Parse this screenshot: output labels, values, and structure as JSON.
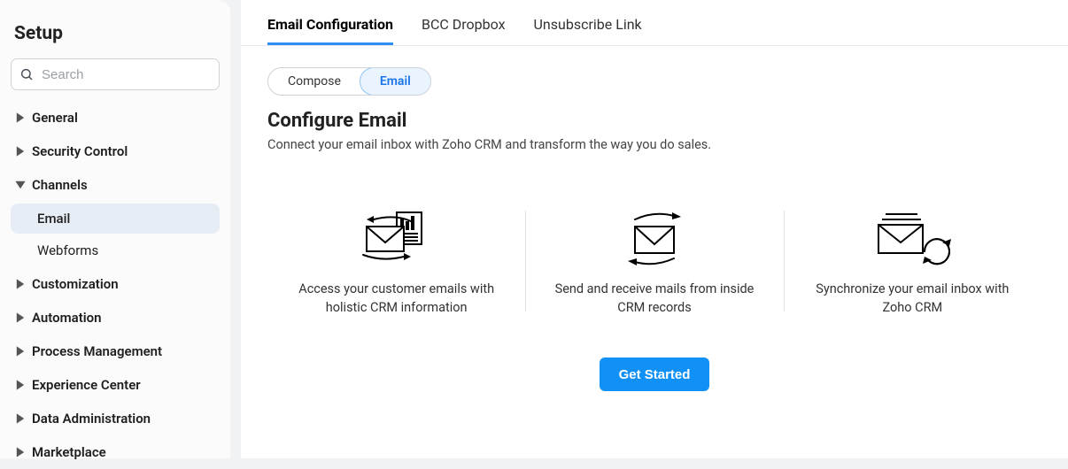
{
  "sidebar": {
    "title": "Setup",
    "search_placeholder": "Search",
    "items": [
      {
        "label": "General",
        "expanded": false
      },
      {
        "label": "Security Control",
        "expanded": false
      },
      {
        "label": "Channels",
        "expanded": true,
        "children": [
          {
            "label": "Email",
            "active": true
          },
          {
            "label": "Webforms",
            "active": false
          }
        ]
      },
      {
        "label": "Customization",
        "expanded": false
      },
      {
        "label": "Automation",
        "expanded": false
      },
      {
        "label": "Process Management",
        "expanded": false
      },
      {
        "label": "Experience Center",
        "expanded": false
      },
      {
        "label": "Data Administration",
        "expanded": false
      },
      {
        "label": "Marketplace",
        "expanded": false
      }
    ]
  },
  "tabs": [
    {
      "label": "Email Configuration",
      "active": true
    },
    {
      "label": "BCC Dropbox",
      "active": false
    },
    {
      "label": "Unsubscribe Link",
      "active": false
    }
  ],
  "pills": [
    {
      "label": "Compose",
      "active": false
    },
    {
      "label": "Email",
      "active": true
    }
  ],
  "section": {
    "title": "Configure Email",
    "description": "Connect your email inbox with Zoho CRM and transform the way you do sales."
  },
  "features": [
    {
      "text": "Access your customer emails with holistic CRM information",
      "icon": "email-doc-sync"
    },
    {
      "text": "Send and receive mails from inside CRM records",
      "icon": "email-send-receive"
    },
    {
      "text": "Synchronize your email inbox with Zoho CRM",
      "icon": "email-stack-sync"
    }
  ],
  "cta_label": "Get Started"
}
